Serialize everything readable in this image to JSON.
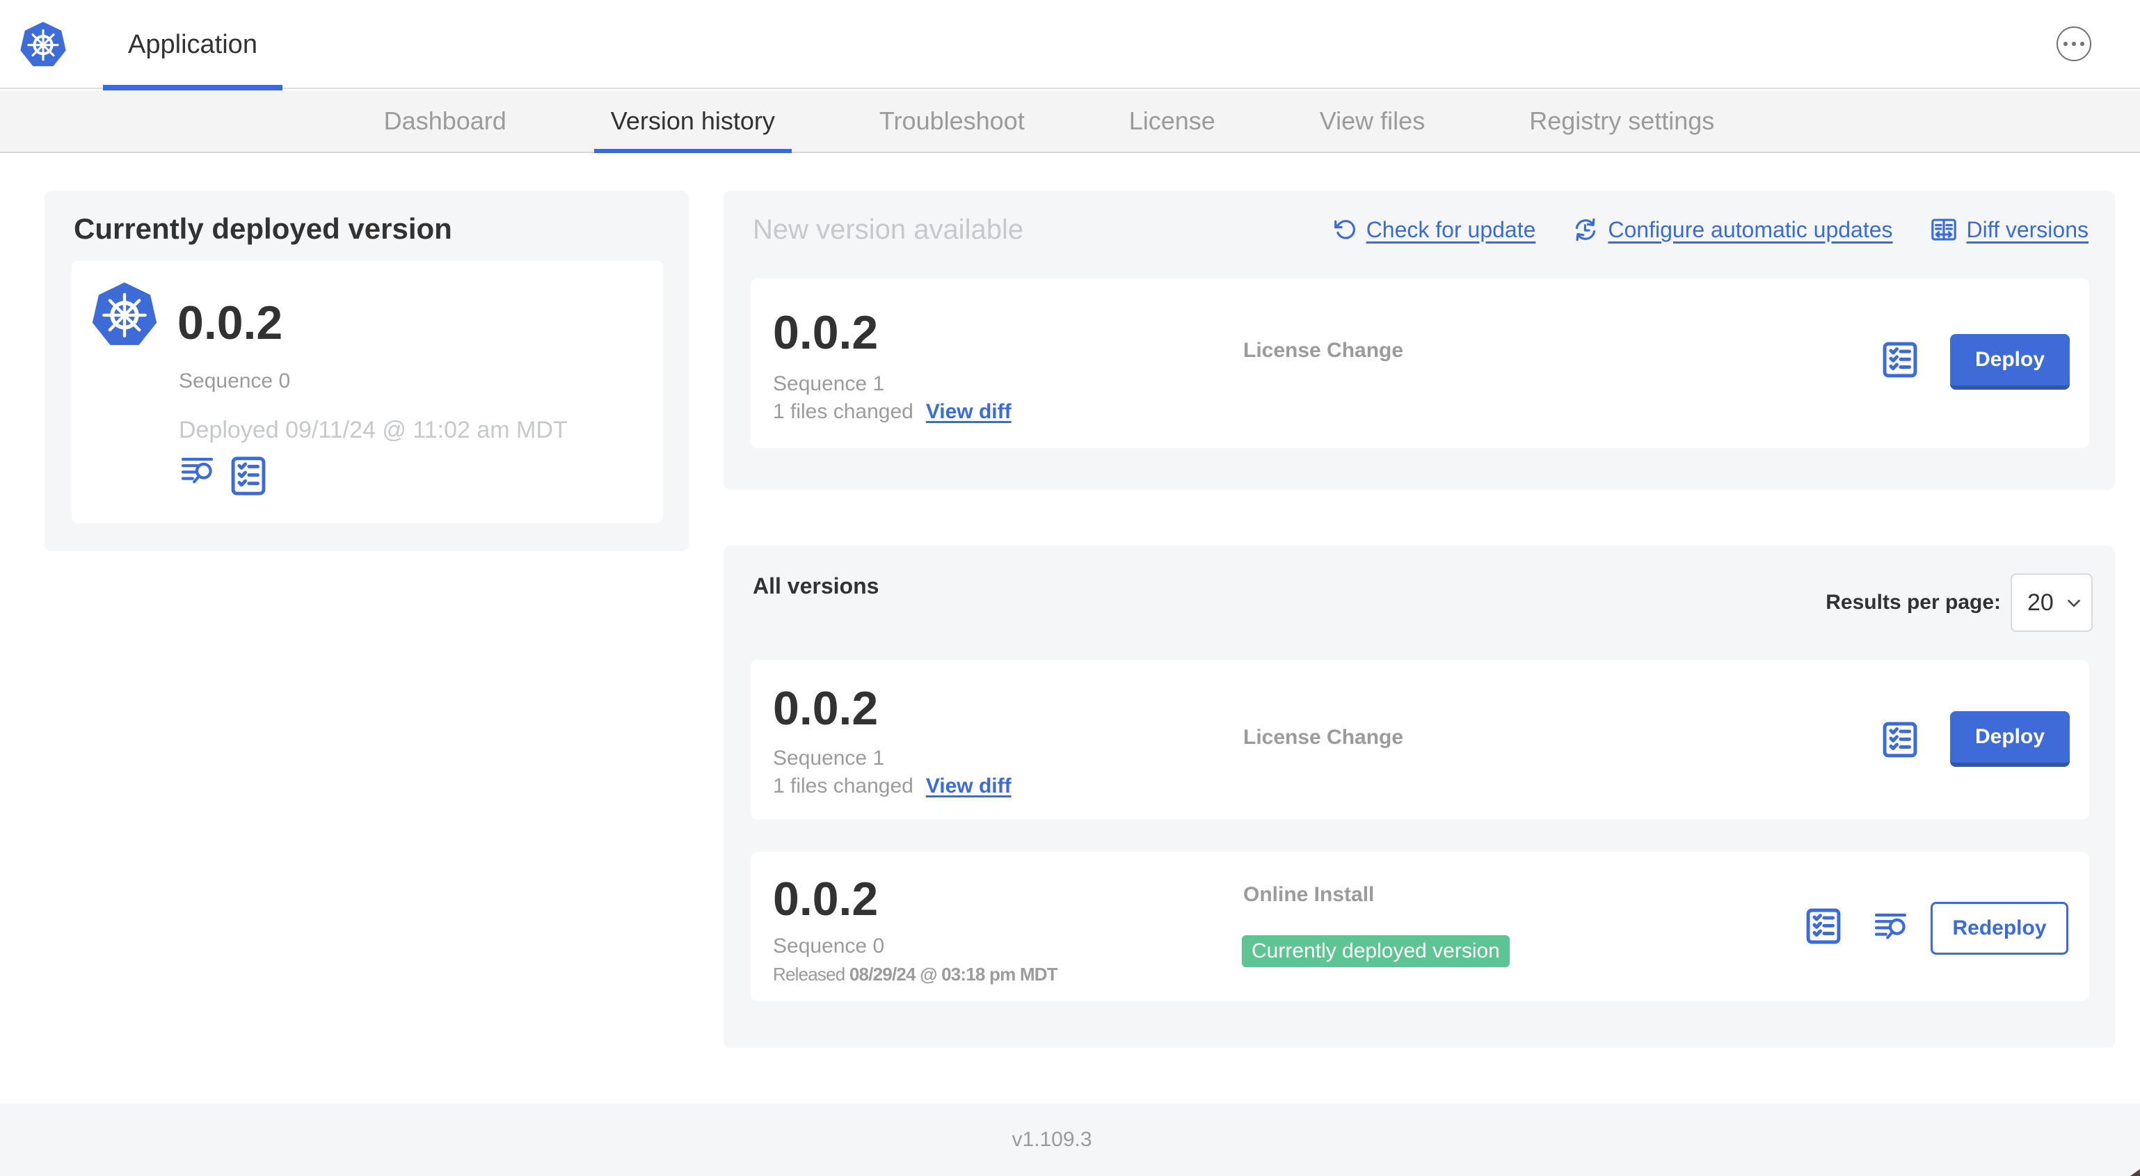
{
  "colors": {
    "accent_blue": "#3b6bd9",
    "button_blue": "#3d6cd8",
    "success_green": "#5ec494",
    "text_dark": "#323232",
    "text_gray": "#9b9b9b",
    "text_light_gray": "#c6c9cc",
    "panel_gray": "#f4f6f8",
    "tabbar_gray": "#f4f4f5"
  },
  "navbar": {
    "app_label": "Application",
    "menu_icon": "ellipsis-menu-icon",
    "logo_icon": "kubernetes-logo"
  },
  "tabs": {
    "items": [
      "Dashboard",
      "Version history",
      "Troubleshoot",
      "License",
      "View files",
      "Registry settings"
    ],
    "active": "Version history"
  },
  "deployed_panel": {
    "heading": "Currently deployed version",
    "version": "0.0.2",
    "sequence": "Sequence 0",
    "deployed_at": "Deployed 09/11/24 @ 11:02 am MDT",
    "icons": [
      "view-logs-icon",
      "preflight-checks-icon"
    ]
  },
  "update_panel": {
    "heading": "New version available",
    "actions": [
      {
        "label": "Check for update",
        "icon": "refresh-icon"
      },
      {
        "label": "Configure automatic updates",
        "icon": "auto-update-schedule-icon"
      },
      {
        "label": "Diff versions",
        "icon": "diff-versions-icon"
      }
    ],
    "card": {
      "version": "0.0.2",
      "sequence": "Sequence 1",
      "files_changed": "1 files changed",
      "view_diff_label": "View diff",
      "source": "License Change",
      "deploy_label": "Deploy",
      "icons": [
        "preflight-checks-icon"
      ]
    }
  },
  "all_versions_panel": {
    "heading": "All versions",
    "results_per_page_label": "Results per page:",
    "results_per_page_value": "20",
    "rows": [
      {
        "version": "0.0.2",
        "sequence": "Sequence 1",
        "files_changed": "1 files changed",
        "view_diff_label": "View diff",
        "source": "License Change",
        "action_label": "Deploy",
        "icons": [
          "preflight-checks-icon"
        ]
      },
      {
        "version": "0.0.2",
        "sequence": "Sequence 0",
        "released_prefix": "Released ",
        "released_at": "08/29/24 @ 03:18 pm MDT",
        "source": "Online Install",
        "status_badge": "Currently deployed version",
        "action_label": "Redeploy",
        "icons": [
          "preflight-checks-icon",
          "view-logs-icon"
        ]
      }
    ]
  },
  "footer": {
    "app_version": "v1.109.3"
  }
}
